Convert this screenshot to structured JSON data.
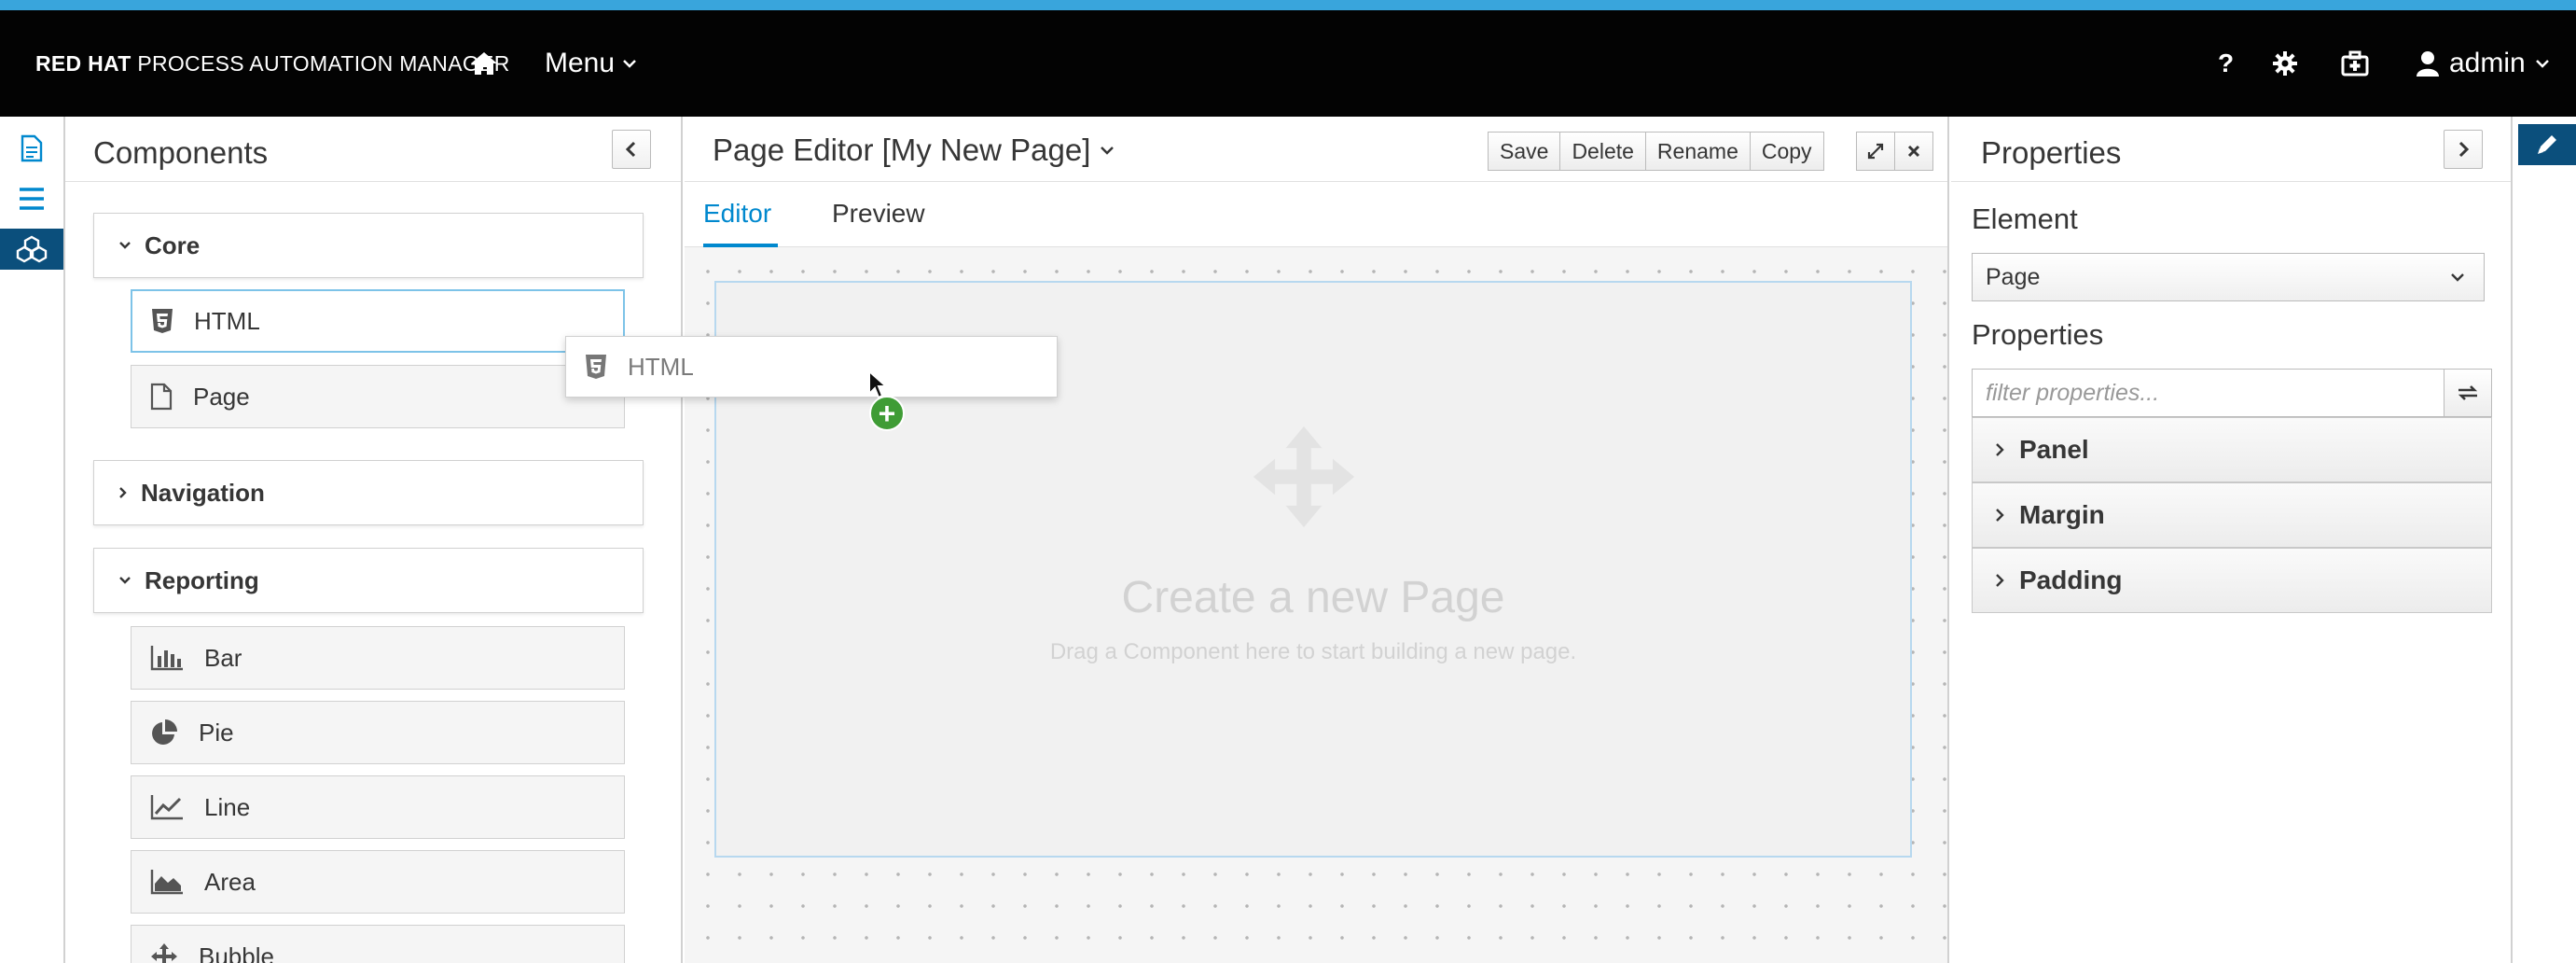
{
  "masthead": {
    "brand_bold": "RED HAT",
    "brand_rest": " PROCESS AUTOMATION MANAGER",
    "menu_label": "Menu",
    "help_label": "?",
    "user_label": "admin"
  },
  "components": {
    "title": "Components",
    "groups": [
      {
        "label": "Core",
        "expanded": true
      },
      {
        "label": "Navigation",
        "expanded": false
      },
      {
        "label": "Reporting",
        "expanded": true
      }
    ],
    "core_items": [
      {
        "label": "HTML",
        "icon": "html5-icon"
      },
      {
        "label": "Page",
        "icon": "file-icon"
      }
    ],
    "reporting_items": [
      {
        "label": "Bar",
        "icon": "bar-chart-icon"
      },
      {
        "label": "Pie",
        "icon": "pie-chart-icon"
      },
      {
        "label": "Line",
        "icon": "line-chart-icon"
      },
      {
        "label": "Area",
        "icon": "area-chart-icon"
      },
      {
        "label": "Bubble",
        "icon": "move-icon"
      }
    ]
  },
  "editor": {
    "title": "Page Editor [My New Page]",
    "buttons": {
      "save": "Save",
      "delete": "Delete",
      "rename": "Rename",
      "copy": "Copy"
    },
    "tabs": [
      {
        "label": "Editor",
        "active": true
      },
      {
        "label": "Preview",
        "active": false
      }
    ],
    "drop_title": "Create a new Page",
    "drop_subtitle": "Drag a Component here to start building a new page.",
    "drag_ghost_label": "HTML"
  },
  "properties": {
    "title": "Properties",
    "element_label": "Element",
    "element_selected": "Page",
    "properties_label": "Properties",
    "filter_placeholder": "filter properties...",
    "sections": [
      "Panel",
      "Margin",
      "Padding"
    ]
  },
  "colors": {
    "accent": "#0088ce",
    "rail_active": "#0b4f7c",
    "masthead": "#030303",
    "add_badge": "#3f9c35"
  }
}
